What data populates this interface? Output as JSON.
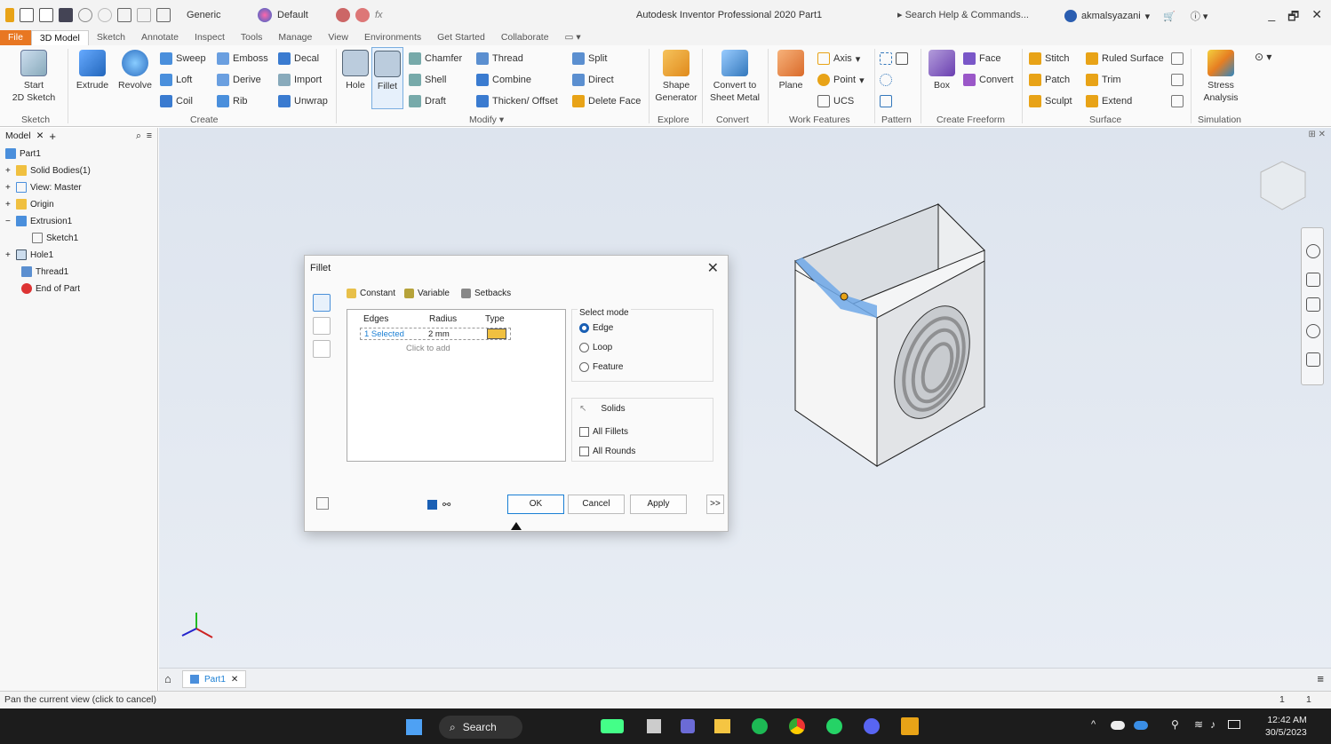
{
  "titlebar": {
    "appearance": "Generic",
    "style": "Default",
    "app_title": "Autodesk Inventor Professional 2020   Part1",
    "search": "Search Help & Commands...",
    "user": "akmalsyazani",
    "controls": [
      "_",
      "🗗",
      "×"
    ]
  },
  "tabs": [
    "File",
    "3D Model",
    "Sketch",
    "Annotate",
    "Inspect",
    "Tools",
    "Manage",
    "View",
    "Environments",
    "Get Started",
    "Collaborate"
  ],
  "ribbon": {
    "start_sketch": "Start\n2D Sketch",
    "extrude": "Extrude",
    "revolve": "Revolve",
    "sweep": "Sweep",
    "emboss": "Emboss",
    "decal": "Decal",
    "loft": "Loft",
    "derive": "Derive",
    "import": "Import",
    "coil": "Coil",
    "rib": "Rib",
    "unwrap": "Unwrap",
    "hole": "Hole",
    "fillet": "Fillet",
    "chamfer": "Chamfer",
    "thread": "Thread",
    "split": "Split",
    "shell": "Shell",
    "combine": "Combine",
    "direct": "Direct",
    "draft": "Draft",
    "thicken": "Thicken/ Offset",
    "delete_face": "Delete Face",
    "shape_gen": "Shape\nGenerator",
    "convert_sm": "Convert to\nSheet Metal",
    "plane": "Plane",
    "axis": "Axis",
    "point": "Point",
    "ucs": "UCS",
    "box": "Box",
    "face": "Face",
    "convert": "Convert",
    "stitch": "Stitch",
    "ruled": "Ruled Surface",
    "patch": "Patch",
    "trim": "Trim",
    "sculpt": "Sculpt",
    "extend": "Extend",
    "stress": "Stress\nAnalysis",
    "panels": {
      "sketch": "Sketch",
      "create": "Create",
      "modify": "Modify ▾",
      "explore": "Explore",
      "convert": "Convert",
      "work": "Work Features",
      "pattern": "Pattern",
      "freeform": "Create Freeform",
      "surface": "Surface",
      "simulation": "Simulation"
    }
  },
  "browser": {
    "tab": "Model",
    "tree": [
      {
        "label": "Part1",
        "indent": 0
      },
      {
        "label": "Solid Bodies(1)",
        "indent": 1
      },
      {
        "label": "View: Master",
        "indent": 1
      },
      {
        "label": "Origin",
        "indent": 1
      },
      {
        "label": "Extrusion1",
        "indent": 1
      },
      {
        "label": "Sketch1",
        "indent": 2
      },
      {
        "label": "Hole1",
        "indent": 1
      },
      {
        "label": "Thread1",
        "indent": 1
      },
      {
        "label": "End of Part",
        "indent": 1
      }
    ]
  },
  "dialog": {
    "title": "Fillet",
    "tabs": [
      "Constant",
      "Variable",
      "Setbacks"
    ],
    "columns": [
      "Edges",
      "Radius",
      "Type"
    ],
    "row": {
      "edges": "1 Selected",
      "radius": "2 mm"
    },
    "click_to_add": "Click to add",
    "select_mode_label": "Select mode",
    "modes": [
      "Edge",
      "Loop",
      "Feature"
    ],
    "solids": "Solids",
    "all_fillets": "All Fillets",
    "all_rounds": "All Rounds",
    "ok": "OK",
    "cancel": "Cancel",
    "apply": "Apply",
    "more": ">>"
  },
  "doc_tab": "Part1",
  "status": {
    "message": "Pan the current view (click to cancel)",
    "n1": "1",
    "n2": "1"
  },
  "taskbar": {
    "search": "Search",
    "time": "12:42 AM",
    "date": "30/5/2023"
  },
  "colors": {
    "file_tab": "#e87722",
    "accent": "#1a7fd4",
    "viewport": "#e2e8f0"
  }
}
